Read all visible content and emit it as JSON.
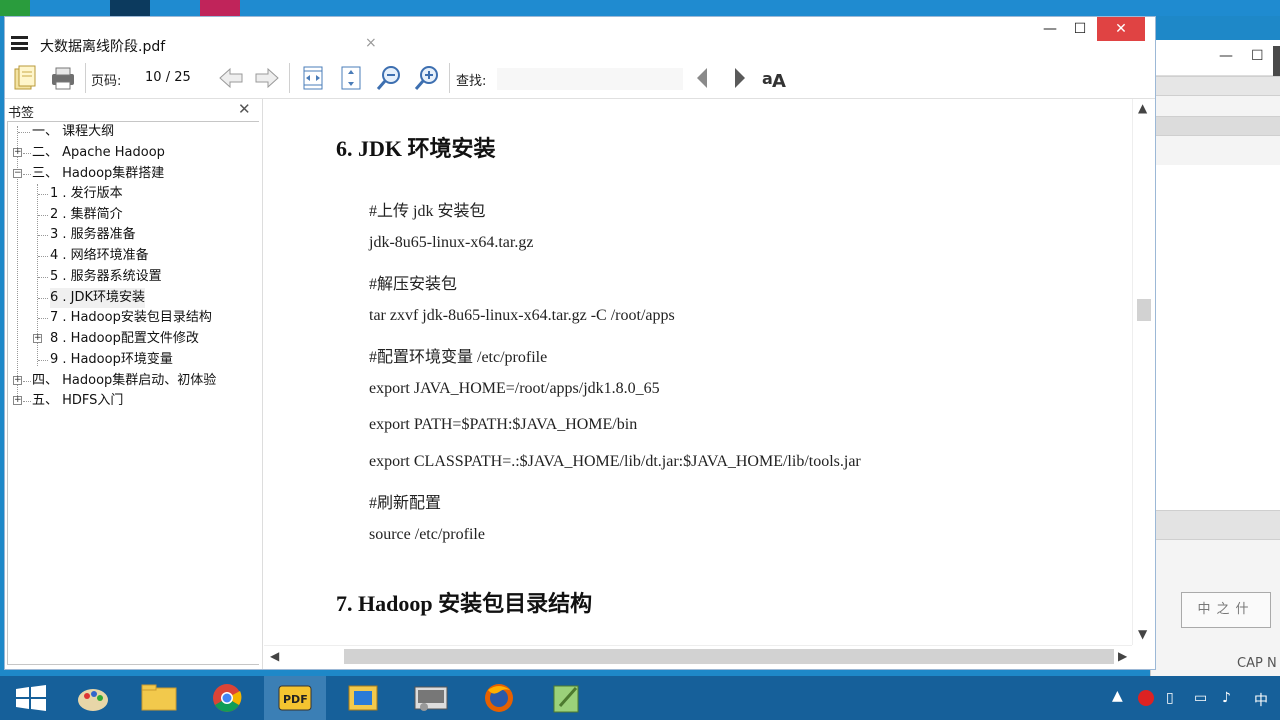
{
  "window": {
    "doc_title": "大数据离线阶段.pdf",
    "tab_close": "×",
    "minimize": "—",
    "maximize": "☐",
    "close": "✕"
  },
  "toolbar": {
    "page_label": "页码:",
    "page_current": "10",
    "page_total": "/ 25",
    "find_label": "查找:",
    "find_value": ""
  },
  "bookmarks": {
    "header": "书签",
    "close": "✕",
    "items": [
      {
        "label": "一、 课程大纲"
      },
      {
        "label": "二、 Apache Hadoop"
      },
      {
        "label": "三、 Hadoop集群搭建"
      },
      {
        "label": "1 . 发行版本"
      },
      {
        "label": "2 . 集群简介"
      },
      {
        "label": "3 . 服务器准备"
      },
      {
        "label": "4 . 网络环境准备"
      },
      {
        "label": "5 . 服务器系统设置"
      },
      {
        "label": "6 . JDK环境安装"
      },
      {
        "label": "7 . Hadoop安装包目录结构"
      },
      {
        "label": "8 . Hadoop配置文件修改"
      },
      {
        "label": "9 . Hadoop环境变量"
      },
      {
        "label": "四、 Hadoop集群启动、初体验"
      },
      {
        "label": "五、 HDFS入门"
      }
    ]
  },
  "document": {
    "section6": "6.   JDK 环境安装",
    "lines": [
      "#上传 jdk 安装包",
      "jdk-8u65-linux-x64.tar.gz",
      "#解压安装包",
      "tar zxvf jdk-8u65-linux-x64.tar.gz -C /root/apps",
      "#配置环境变量 /etc/profile",
      "export JAVA_HOME=/root/apps/jdk1.8.0_65",
      "export PATH=$PATH:$JAVA_HOME/bin",
      "export CLASSPATH=.:$JAVA_HOME/lib/dt.jar:$JAVA_HOME/lib/tools.jar",
      "#刷新配置",
      "source /etc/profile"
    ],
    "section7": "7.   Hadoop 安装包目录结构"
  },
  "background_window": {
    "stamp": "中之什",
    "status": "CAP  N"
  },
  "taskbar": {
    "ime": "中"
  },
  "colors": {
    "close_red": "#e04343",
    "taskbar": "#16609a",
    "desktop": "#1f8bd0"
  }
}
